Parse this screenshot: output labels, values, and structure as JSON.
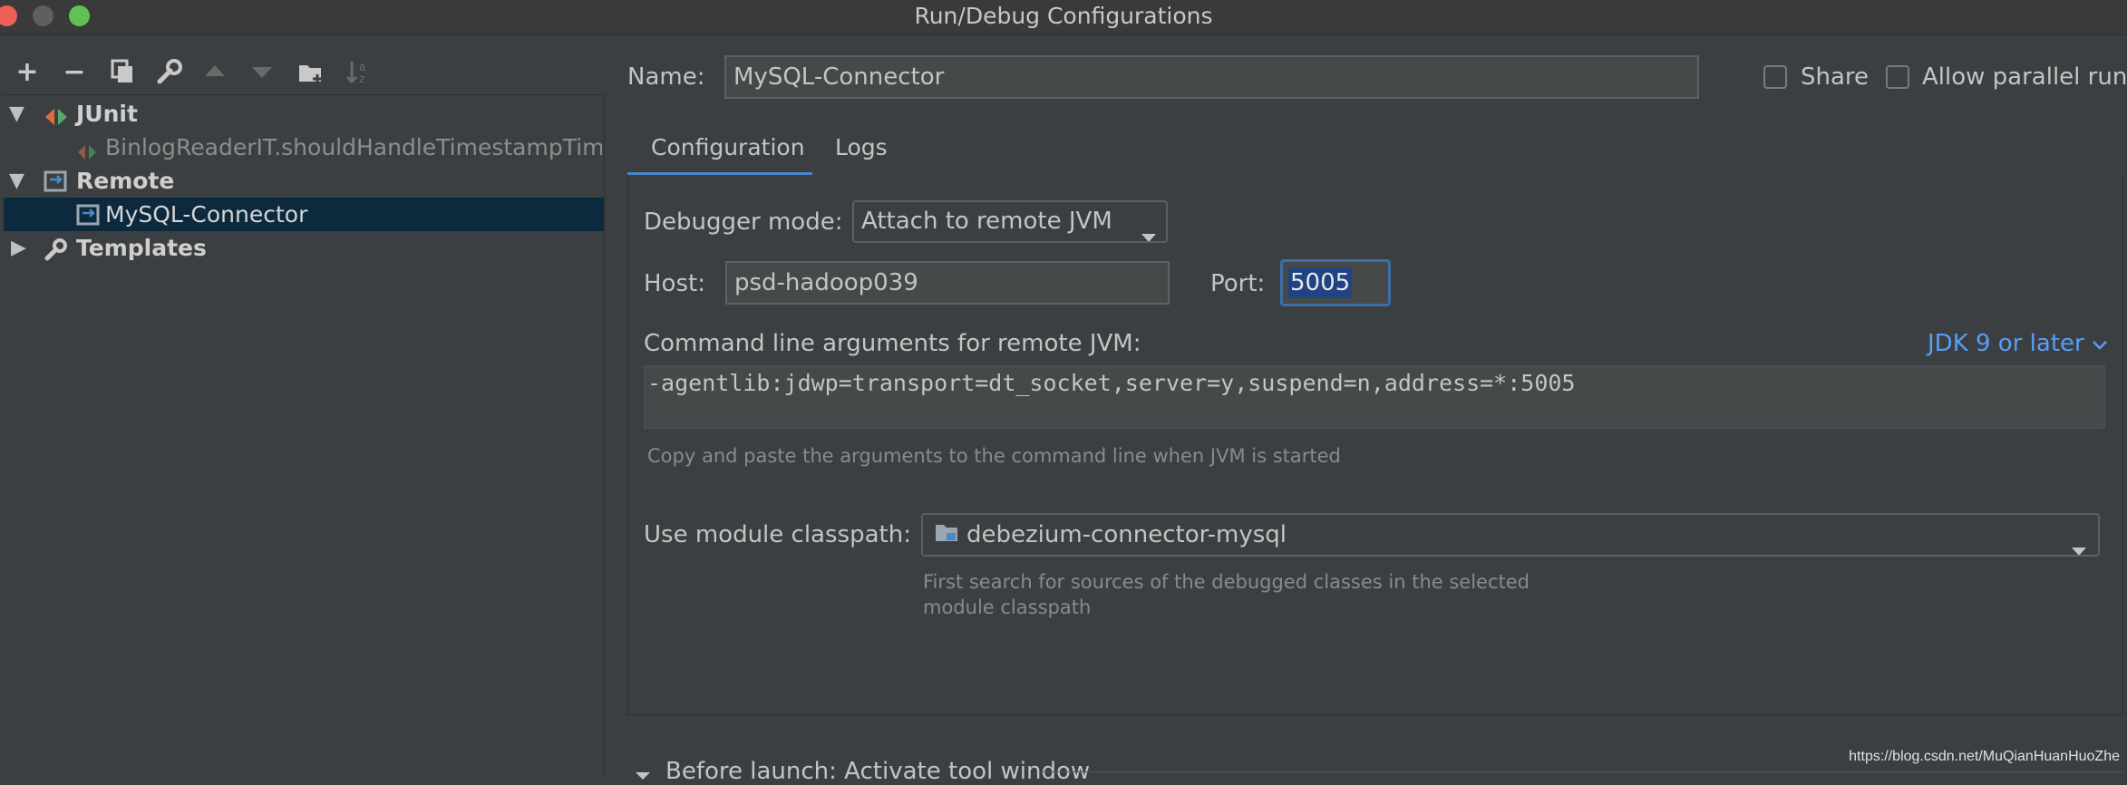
{
  "window": {
    "title": "Run/Debug Configurations"
  },
  "toolbar": {
    "add": "+",
    "remove": "−"
  },
  "tree": {
    "groups": [
      {
        "label": "JUnit",
        "child": "BinlogReaderIT.shouldHandleTimestampTim"
      },
      {
        "label": "Remote",
        "child": "MySQL-Connector"
      },
      {
        "label": "Templates"
      }
    ]
  },
  "form": {
    "name_label": "Name:",
    "name_value": "MySQL-Connector",
    "share_label": "Share",
    "parallel_label": "Allow parallel run",
    "tabs": [
      "Configuration",
      "Logs"
    ],
    "debugger_mode_label": "Debugger mode:",
    "debugger_mode_value": "Attach to remote JVM",
    "host_label": "Host:",
    "host_value": "psd-hadoop039",
    "port_label": "Port:",
    "port_value": "5005",
    "cmd_label": "Command line arguments for remote JVM:",
    "jdk_link": "JDK 9 or later",
    "cmd_value": "-agentlib:jdwp=transport=dt_socket,server=y,suspend=n,address=*:5005",
    "cmd_hint": "Copy and paste the arguments to the command line when JVM is started",
    "classpath_label": "Use module classpath:",
    "classpath_value": "debezium-connector-mysql",
    "classpath_hint_1": "First search for sources of the debugged classes in the selected",
    "classpath_hint_2": "module classpath",
    "before_launch": "Before launch: Activate tool window"
  },
  "watermark": "https://blog.csdn.net/MuQianHuanHuoZhe",
  "colors": {
    "selection": "#0d293e",
    "accent": "#4a88c7",
    "link": "#589df6",
    "port_highlight": "#214283"
  }
}
